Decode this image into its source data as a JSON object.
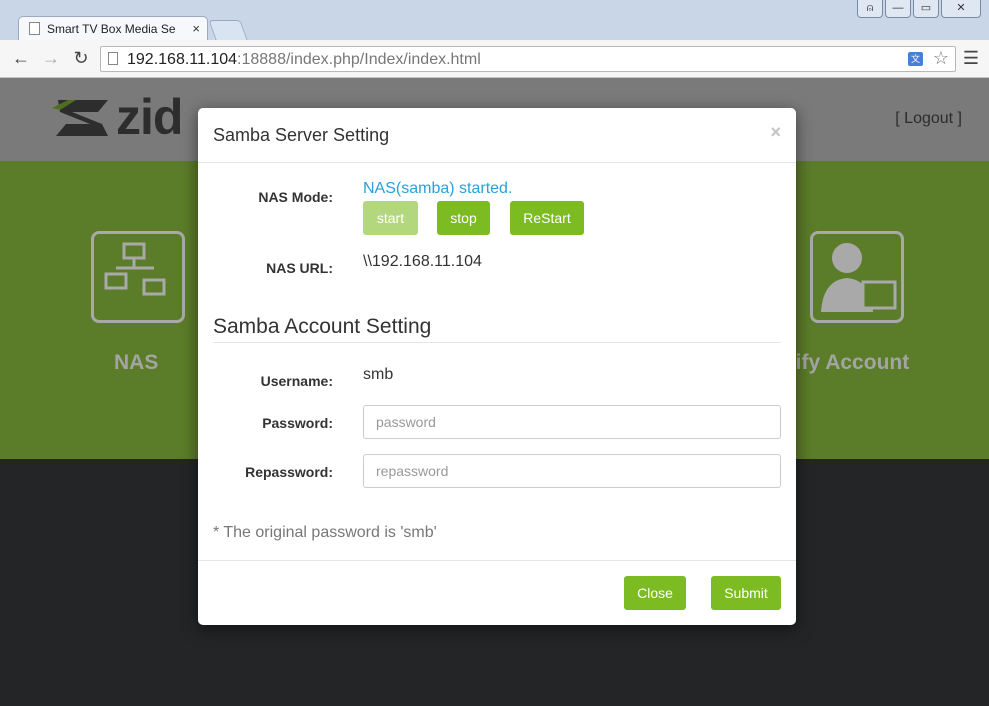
{
  "browser": {
    "tab_title": "Smart TV Box Media Se",
    "tab_close": "×",
    "url_host": "192.168.11.104",
    "url_rest": ":18888/index.php/Index/index.html",
    "translate_label": "文",
    "win_buttons": [
      "⍝",
      "—",
      "▭",
      "✕"
    ]
  },
  "page": {
    "logo": "zid",
    "logout": "[ Logout ]",
    "tiles": {
      "nas": "NAS",
      "account": "odify Account"
    }
  },
  "modal": {
    "title": "Samba Server Setting",
    "close": "×",
    "nas_mode_label": "NAS Mode:",
    "nas_status": "NAS(samba) started.",
    "buttons": {
      "start": "start",
      "stop": "stop",
      "restart": "ReStart"
    },
    "nas_url_label": "NAS URL:",
    "nas_url": "\\\\192.168.11.104",
    "account_section": "Samba Account Setting",
    "username_label": "Username:",
    "username": "smb",
    "password_label": "Password:",
    "password_placeholder": "password",
    "repassword_label": "Repassword:",
    "repassword_placeholder": "repassword",
    "note": "*  The original password is 'smb'",
    "close_button": "Close",
    "submit_button": "Submit"
  },
  "colors": {
    "accent_green": "#7cbc22",
    "status_blue": "#2aa0da",
    "band_green": "#5b7c29"
  }
}
